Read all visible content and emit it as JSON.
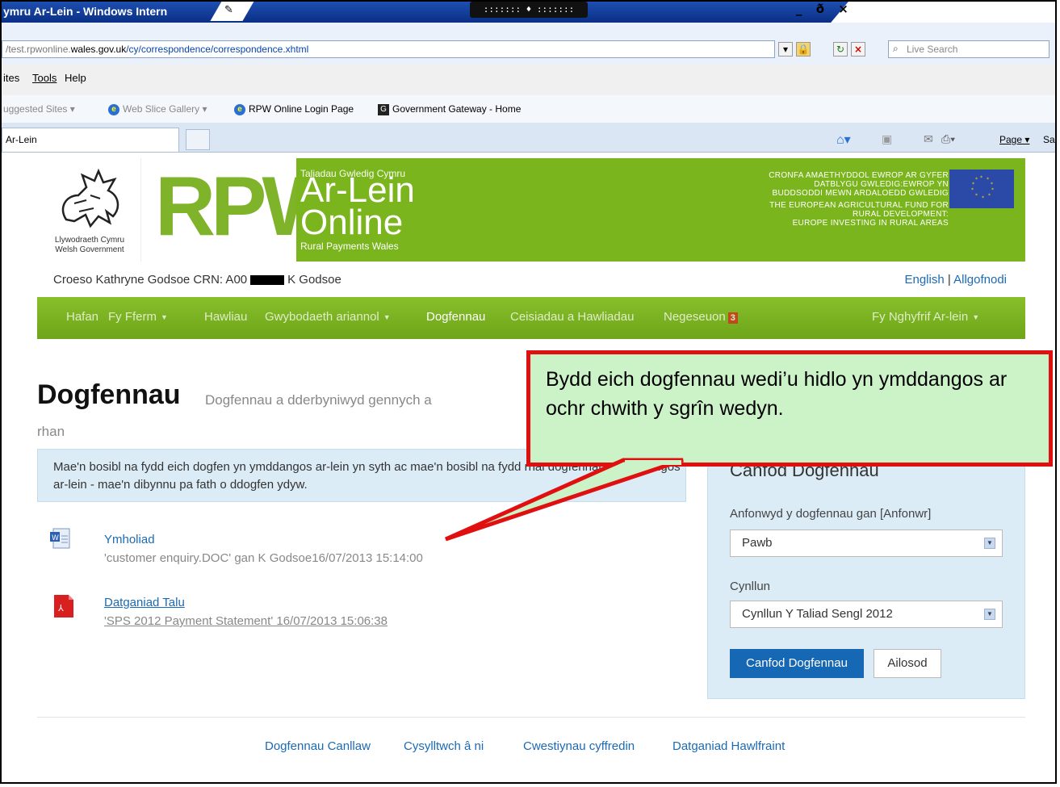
{
  "browser": {
    "title": "ymru Ar-Lein - Windows Intern",
    "window_controls": "_ ð ×",
    "grip": "::::::: ♦ :::::::",
    "address": {
      "prefix": "/test.rpwonline.",
      "host": "wales.gov.uk",
      "path": "/cy/correspondence/correspondence.xhtml"
    },
    "search_placeholder": "Live Search",
    "menu": [
      "ites",
      "Tools",
      "Help"
    ],
    "favorites": [
      "uggested Sites ▾",
      "Web Slice Gallery ▾",
      "RPW Online Login Page",
      "Government Gateway - Home"
    ],
    "tab_label": "Ar-Lein",
    "command_bar": [
      "Page ▾",
      "Sa"
    ]
  },
  "banner": {
    "gov_line1": "Llywodraeth Cymru",
    "gov_line2": "Welsh Government",
    "rpw": "RPW",
    "taliadau": "Taliadau Gwledig Cymru",
    "arlein": "Ar-Lein",
    "online": "Online",
    "rural_payments": "Rural Payments Wales",
    "eu_cy_1": "CRONFA AMAETHYDDOL EWROP AR GYFER",
    "eu_cy_2": "DATBLYGU GWLEDIG:EWROP YN",
    "eu_cy_3": "BUDDSODDI MEWN ARDALOEDD GWLEDIG",
    "eu_en_1": "THE EUROPEAN AGRICULTURAL FUND FOR",
    "eu_en_2": "RURAL DEVELOPMENT:",
    "eu_en_3": "EUROPE INVESTING IN RURAL AREAS"
  },
  "welcome": {
    "prefix": "Croeso Kathryne Godsoe CRN: A00",
    "suffix": "K Godsoe"
  },
  "toplinks": {
    "english": "English",
    "sep": "|",
    "logout": "Allgofnodi"
  },
  "nav": {
    "hafan": "Hafan",
    "fferm": "Fy Fferm",
    "hawliau": "Hawliau",
    "ariannol": "Gwybodaeth ariannol",
    "dogfennau": "Dogfennau",
    "ceisiadau": "Ceisiadau a Hawliadau",
    "negeseuon": "Negeseuon",
    "negeseuon_count": "3",
    "cyfrif": "Fy Nghyfrif Ar-lein"
  },
  "page": {
    "title": "Dogfennau",
    "subtitle": "Dogfennau a dderbyniwyd gennych a",
    "subtitle_cont": "rhan",
    "info": "Mae'n bosibl na fydd eich dogfen yn ymddangos ar-lein yn syth ac mae'n bosibl na fydd rhai dogfennau'n ymddangos ar-lein - mae'n dibynnu pa fath o ddogfen ydyw."
  },
  "documents": [
    {
      "title": "Ymholiad",
      "detail": "'customer enquiry.DOC' gan K Godsoe16/07/2013 15:14:00"
    },
    {
      "title": "Datganiad Talu",
      "detail": "'SPS 2012 Payment Statement' 16/07/2013 15:06:38"
    }
  ],
  "filter": {
    "title": "Canfod Dogfennau",
    "sender_label": "Anfonwyd y dogfennau gan [Anfonwr]",
    "sender_value": "Pawb",
    "scheme_label": "Cynllun",
    "scheme_value": "Cynllun Y Taliad Sengl 2012",
    "find_button": "Canfod Dogfennau",
    "reset_button": "Ailosod"
  },
  "footer": [
    "Dogfennau Canllaw",
    "Cysylltwch â ni",
    "Cwestiynau cyffredin",
    "Datganiad Hawlfraint"
  ],
  "callout": {
    "text": "Bydd eich dogfennau wedi’u hidlo yn ymddangos ar ochr chwith y sgrîn wedyn."
  },
  "colors": {
    "green": "#7ab51d",
    "link": "#1a6ab5",
    "callout_bg": "#ccf2c8",
    "callout_border": "#e01010",
    "button_blue": "#1667b4"
  }
}
